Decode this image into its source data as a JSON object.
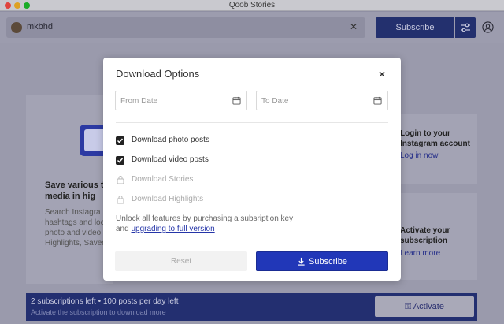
{
  "window": {
    "title": "Qoob Stories"
  },
  "header": {
    "account_name": "mkbhd",
    "subscribe_label": "Subscribe"
  },
  "left_panel": {
    "title_line1": "Save various type",
    "title_line2": "media in hig",
    "desc_line1": "Search Instagra",
    "desc_line2": "hashtags and loca",
    "desc_line3": "photo and video",
    "desc_line4": "Highlights, Saved"
  },
  "right_cards": [
    {
      "title_line1": "Login to your",
      "title_line2": "Instagram account",
      "link": "Log in now"
    },
    {
      "title_line1": "Activate your",
      "title_line2": "subscription",
      "link": "Learn more"
    }
  ],
  "footer": {
    "main_text": "2 subscriptions left • 100 posts per day left",
    "sub_text": "Activate the subscription to download more",
    "activate_label": "Activate"
  },
  "modal": {
    "title": "Download Options",
    "from_placeholder": "From Date",
    "to_placeholder": "To Date",
    "options": [
      {
        "label": "Download photo posts",
        "checked": true,
        "locked": false
      },
      {
        "label": "Download video posts",
        "checked": true,
        "locked": false
      },
      {
        "label": "Download Stories",
        "checked": false,
        "locked": true
      },
      {
        "label": "Download Highlights",
        "checked": false,
        "locked": true
      }
    ],
    "unlock_text": "Unlock all features by purchasing a subsription key",
    "unlock_and": "and",
    "upgrade_link": "upgrading to full version",
    "reset_label": "Reset",
    "subscribe_label": "Subscribe"
  },
  "colors": {
    "accent": "#2137b8",
    "overlay": "#8f8fa3",
    "footer": "#232f70"
  }
}
